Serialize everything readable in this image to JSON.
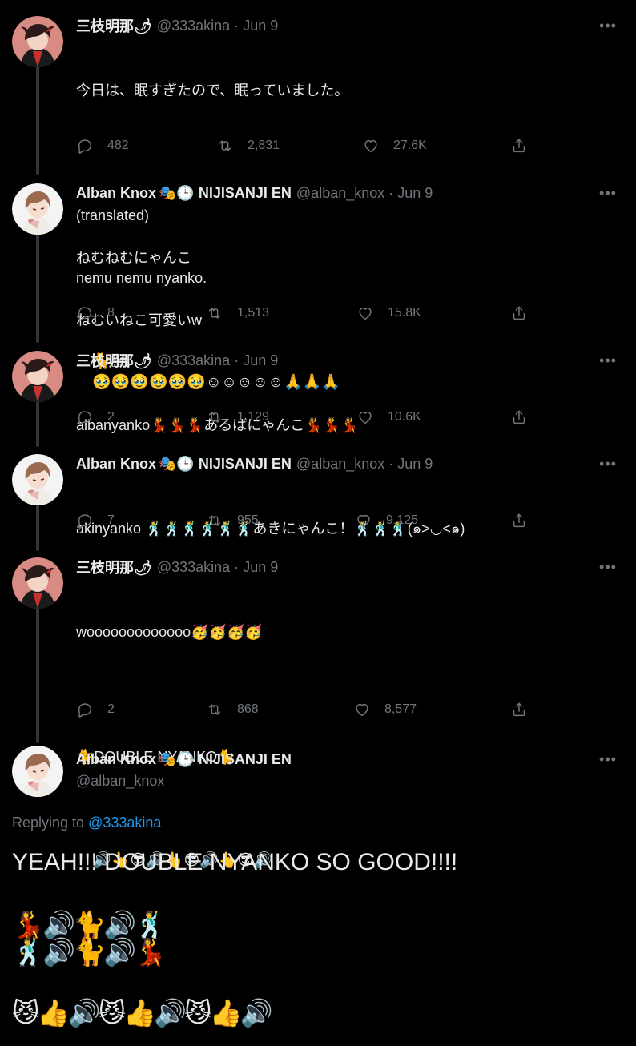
{
  "colors": {
    "background": "#000000",
    "text": "#e7e9ea",
    "muted": "#71767b",
    "link": "#1d9bf0",
    "thread_line": "#333639"
  },
  "tweets": [
    {
      "name": "三枝明那🌶",
      "handle": "@333akina",
      "dot": "·",
      "date": "Jun 9",
      "lines": [
        "今日は、眠すぎたので、眠っていました。",
        "",
        "(translated)",
        "nemu nemu nyanko."
      ],
      "replies": "482",
      "retweets": "2,831",
      "likes": "27.6K"
    },
    {
      "name": "Alban Knox",
      "badge": "🎭🕒",
      "affiliation": "NIJISANJI EN",
      "handle": "@alban_knox",
      "dot": "·",
      "date": "Jun 9",
      "lines": [
        "ねむねむにゃんこ",
        "ねむいねこ可愛いw",
        "🐈🛏",
        "🥹🥹🥹🥹🥹🥹☺☺☺☺☺🙏🙏🙏"
      ],
      "replies": "8",
      "retweets": "1,513",
      "likes": "15.8K"
    },
    {
      "name": "三枝明那🌶",
      "handle": "@333akina",
      "dot": "·",
      "date": "Jun 9",
      "lines": [
        "albanyanko💃💃💃あるばにゃんこ💃💃💃"
      ],
      "replies": "2",
      "retweets": "1,129",
      "likes": "10.6K"
    },
    {
      "name": "Alban Knox",
      "badge": "🎭🕒",
      "affiliation": "NIJISANJI EN",
      "handle": "@alban_knox",
      "dot": "·",
      "date": "Jun 9",
      "lines": [
        "akinyanko 🕺🕺🕺🕺🕺🕺あきにゃんこ！🕺🕺🕺(๑>◡<๑)"
      ],
      "replies": "7",
      "retweets": "955",
      "likes": "9,125"
    },
    {
      "name": "三枝明那🌶",
      "handle": "@333akina",
      "dot": "·",
      "date": "Jun 9",
      "lines": [
        "wooooooooooooo🥳🥳🥳🥳",
        "",
        "🐈DOUBLE NYANKO🐈",
        "",
        "🔊👆😎🔊👆😎🔊👆😎🔊"
      ],
      "replies": "2",
      "retweets": "868",
      "likes": "8,577"
    }
  ],
  "main_tweet": {
    "name": "Alban Knox",
    "badge": "🎭🕒",
    "affiliation": "NIJISANJI EN",
    "handle": "@alban_knox",
    "replying_prefix": "Replying to ",
    "replying_handle": "@333akina",
    "text": "YEAH!!! DOUBLE NYANKO SO GOOD!!!!",
    "emoji_rows": [
      "💃🔊🐈🔊🕺",
      "🕺🔊🐈🔊💃",
      "",
      "😼👍🔊😼👍🔊😼👍🔊"
    ]
  },
  "more_icon": "ellipsis-icon"
}
